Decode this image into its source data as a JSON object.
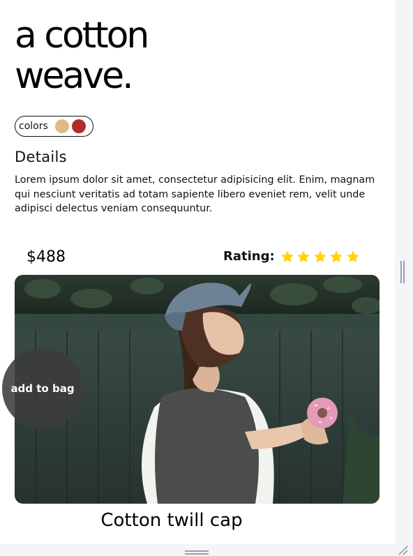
{
  "hero": {
    "line1": "a cotton",
    "line2": "weave."
  },
  "colors": {
    "label": "colors",
    "swatches": [
      {
        "name": "tan",
        "color": "#dfb886"
      },
      {
        "name": "red",
        "color": "#b22a2a"
      }
    ]
  },
  "details": {
    "title": "Details",
    "text": "Lorem ipsum dolor sit amet, consectetur adipisicing elit. Enim, magnam qui nesciunt veritatis ad totam sapiente libero eveniet rem, velit unde adipisci delectus veniam consequuntur."
  },
  "product": {
    "price": "$488",
    "rating_label": "Rating:",
    "rating_value": 5,
    "rating_max": 5,
    "star_color": "#ffd400",
    "add_to_bag": "add to bag",
    "caption": "Cotton twill cap",
    "image_icon": "photo-woman-cap-donut"
  }
}
